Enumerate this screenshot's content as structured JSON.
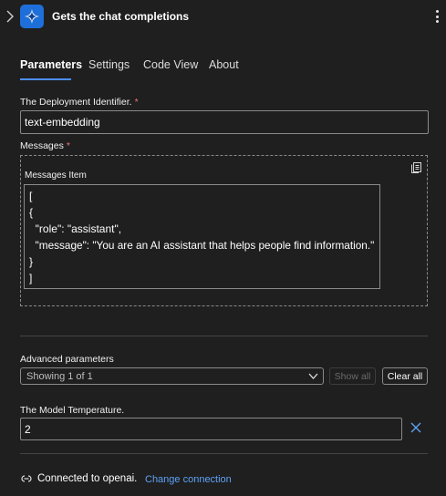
{
  "header": {
    "title": "Gets the chat completions"
  },
  "tabs": [
    {
      "label": "Parameters",
      "active": true
    },
    {
      "label": "Settings"
    },
    {
      "label": "Code View"
    },
    {
      "label": "About"
    }
  ],
  "deployment": {
    "label": "The Deployment Identifier.",
    "required_mark": "*",
    "value": "text-embedding"
  },
  "messages": {
    "label": "Messages",
    "required_mark": "*",
    "item_label": "Messages Item",
    "code_lines": [
      "[",
      "{",
      "  \"role\": \"assistant\",",
      "  \"message\": \"You are an AI assistant that helps people find information.\"",
      "}",
      "]"
    ]
  },
  "advanced": {
    "label": "Advanced parameters",
    "selected": "Showing 1 of 1",
    "show_all": "Show all",
    "clear_all": "Clear all"
  },
  "temperature": {
    "label": "The Model Temperature.",
    "value": "2"
  },
  "connection": {
    "status": "Connected to openai.",
    "change_link": "Change connection"
  },
  "colors": {
    "background": "#1f1f1f",
    "accent": "#4c8df6",
    "link": "#5ea1f5",
    "required": "#f1707b",
    "app_icon": "#1e6fd9"
  },
  "icons": [
    "chevron-right-icon",
    "app-sparkle-icon",
    "more-vertical-icon",
    "copy-icon",
    "chevron-down-icon",
    "close-icon",
    "connection-icon"
  ]
}
